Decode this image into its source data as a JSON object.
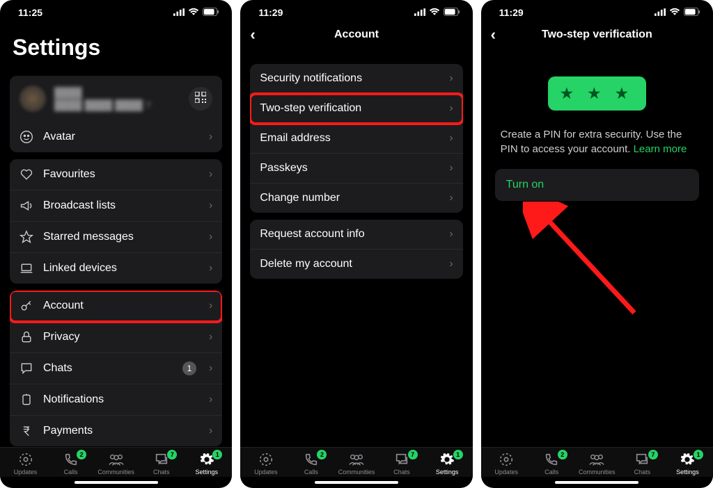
{
  "screen1": {
    "time": "11:25",
    "title": "Settings",
    "profile_placeholder_question": "?",
    "avatar_label": "Avatar",
    "group_fav": {
      "favourites": "Favourites",
      "broadcast": "Broadcast lists",
      "starred": "Starred messages",
      "linked": "Linked devices"
    },
    "group_acct": {
      "account": "Account",
      "privacy": "Privacy",
      "chats": "Chats",
      "chats_badge": "1",
      "notifications": "Notifications",
      "payments": "Payments"
    }
  },
  "screen2": {
    "time": "11:29",
    "title": "Account",
    "group1": {
      "security": "Security notifications",
      "twostep": "Two-step verification",
      "email": "Email address",
      "passkeys": "Passkeys",
      "change_number": "Change number"
    },
    "group2": {
      "request_info": "Request account info",
      "delete": "Delete my account"
    }
  },
  "screen3": {
    "time": "11:29",
    "title": "Two-step verification",
    "pin_stars": "★ ★ ★",
    "description_pre": "Create a PIN for extra security. Use the PIN to access your account. ",
    "learn_more": "Learn more",
    "turn_on": "Turn on"
  },
  "tabs": {
    "updates": "Updates",
    "calls": "Calls",
    "calls_badge": "2",
    "communities": "Communities",
    "chats": "Chats",
    "chats_badge": "7",
    "settings": "Settings",
    "settings_badge": "1"
  }
}
